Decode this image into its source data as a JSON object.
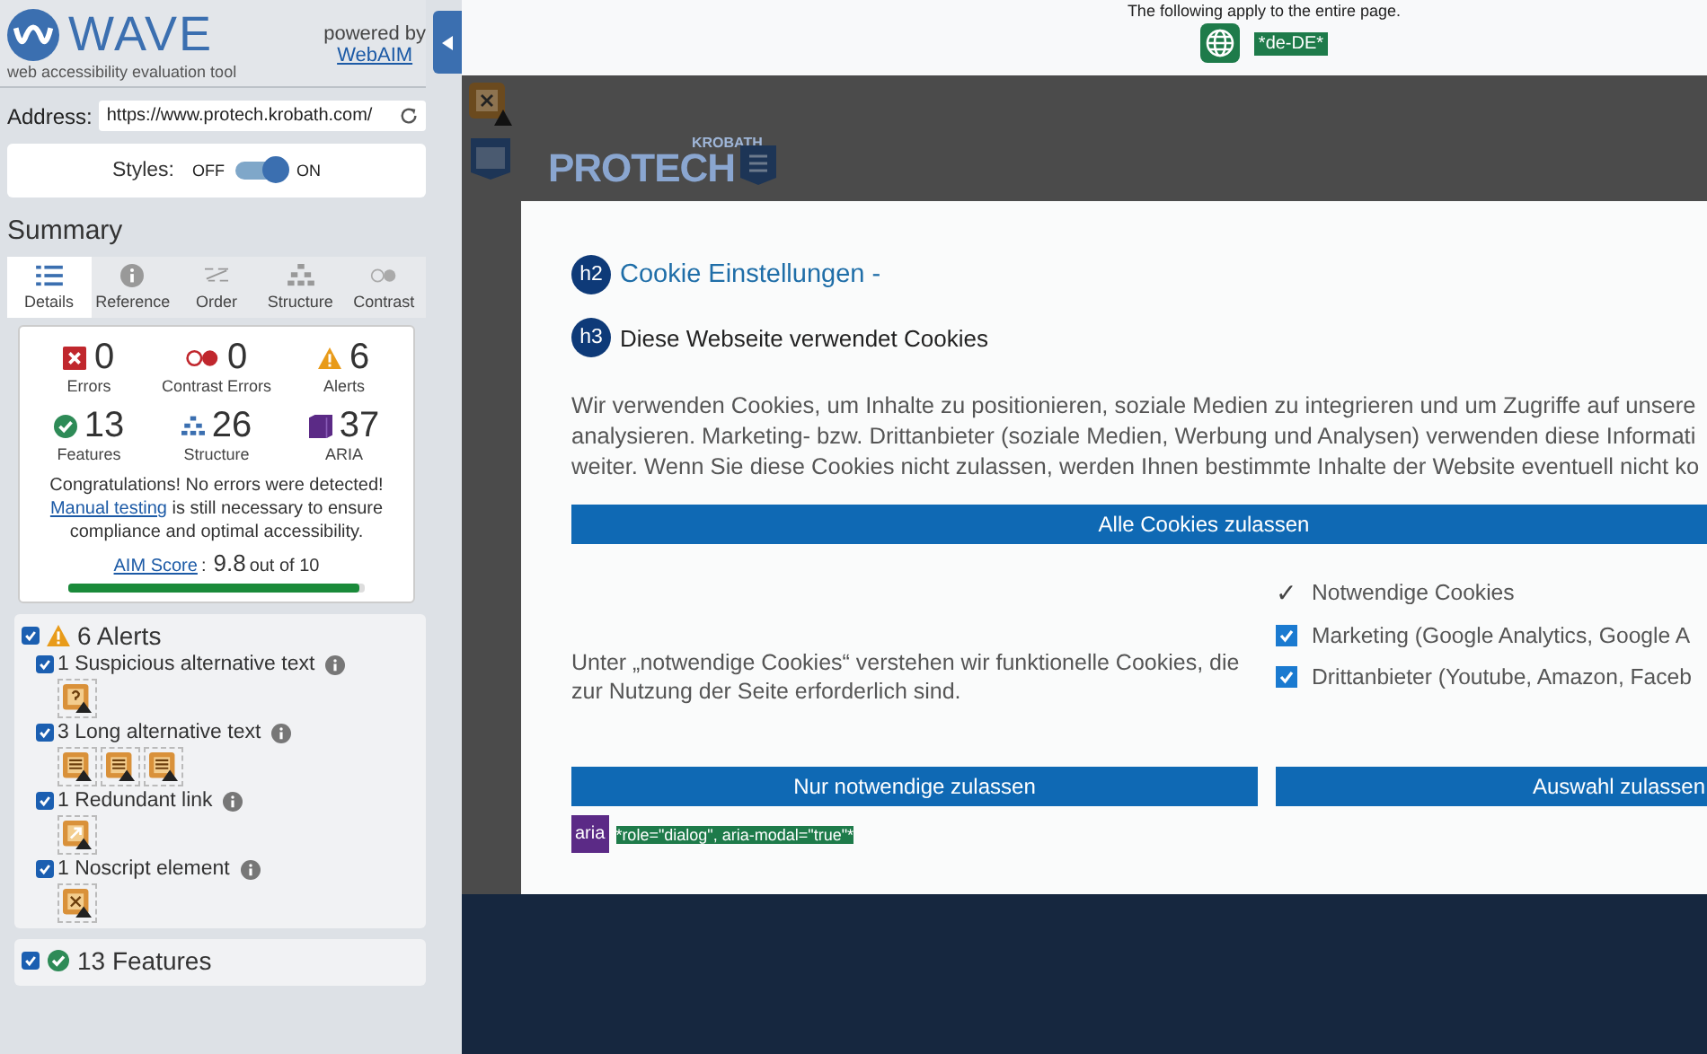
{
  "sidebar": {
    "logo": {
      "name": "WAVE",
      "tagline": "web accessibility evaluation tool"
    },
    "powered_by": "powered by",
    "webaim_link": "WebAIM",
    "address": {
      "label": "Address:",
      "value": "https://www.protech.krobath.com/"
    },
    "styles": {
      "label": "Styles:",
      "off_label": "OFF",
      "on_label": "ON",
      "on": true
    },
    "summary_title": "Summary",
    "tabs": [
      {
        "label": "Details",
        "kind": "details",
        "selected": true
      },
      {
        "label": "Reference",
        "kind": "reference",
        "selected": false
      },
      {
        "label": "Order",
        "kind": "order",
        "selected": false
      },
      {
        "label": "Structure",
        "kind": "structure",
        "selected": false
      },
      {
        "label": "Contrast",
        "kind": "contrast",
        "selected": false
      }
    ],
    "stats": [
      {
        "kind": "errors",
        "count": "0",
        "label": "Errors"
      },
      {
        "kind": "contrast",
        "count": "0",
        "label": "Contrast Errors"
      },
      {
        "kind": "alerts",
        "count": "6",
        "label": "Alerts"
      },
      {
        "kind": "features",
        "count": "13",
        "label": "Features"
      },
      {
        "kind": "structure",
        "count": "26",
        "label": "Structure"
      },
      {
        "kind": "aria",
        "count": "37",
        "label": "ARIA"
      }
    ],
    "message": {
      "before": "Congratulations! No errors were detected! ",
      "link": "Manual testing",
      "after": " is still necessary to ensure compliance and optimal accessibility."
    },
    "aim_score": {
      "label": "AIM Score",
      "separator": ":",
      "value": "9.8",
      "suffix": "out of 10",
      "level": 0.98
    },
    "alerts": {
      "checked": true,
      "title": "6 Alerts",
      "items": [
        {
          "label": "1 Suspicious alternative text",
          "checked": true,
          "icons": [
            {
              "kind": "suspicious"
            }
          ]
        },
        {
          "label": "3 Long alternative text",
          "checked": true,
          "icons": [
            {
              "kind": "long"
            },
            {
              "kind": "long"
            },
            {
              "kind": "long"
            }
          ]
        },
        {
          "label": "1 Redundant link",
          "checked": true,
          "icons": [
            {
              "kind": "redundant"
            }
          ]
        },
        {
          "label": "1 Noscript element",
          "checked": true,
          "icons": [
            {
              "kind": "noscript"
            }
          ]
        }
      ]
    },
    "features": {
      "checked": true,
      "title": "13 Features"
    }
  },
  "page": {
    "notice": "The following apply to the entire page.",
    "language": "*de-DE*",
    "overlay_icons": [
      {
        "kind": "noscript"
      },
      {
        "kind": "document"
      }
    ],
    "logo": {
      "top": "KROBATH",
      "name": "PROTECH"
    },
    "dialog": {
      "h2_badge": "h2",
      "heading": "Cookie Einstellungen -",
      "h3_badge": "h3",
      "subheading": "Diese Webseite verwendet Cookies",
      "lines": [
        "Wir verwenden Cookies, um Inhalte zu positionieren, soziale Medien zu integrieren und um Zugriffe auf unsere",
        "analysieren. Marketing- bzw. Drittanbieter (soziale Medien, Werbung und Analysen) verwenden diese Informati",
        "weiter. Wenn Sie diese Cookies nicht zulassen, werden Ihnen bestimmte Inhalte der Website eventuell nicht ko"
      ],
      "accept_all": "Alle Cookies zulassen",
      "note": "Unter „notwendige Cookies“ verstehen wir funktionelle Cookies, die zur Nutzung der Seite erforderlich sind.",
      "options": [
        {
          "kind": "fixed",
          "mark": "✓",
          "label": "Notwendige Cookies"
        },
        {
          "kind": "checkbox",
          "checked": true,
          "label": "Marketing (Google Analytics, Google A"
        },
        {
          "kind": "checkbox",
          "checked": true,
          "label": "Drittanbieter (Youtube, Amazon, Faceb"
        }
      ],
      "buttons": [
        "Nur notwendige zulassen",
        "Auswahl zulassen"
      ],
      "aria_badge": "aria",
      "aria_label": "*role=\"dialog\", aria-modal=\"true\"*"
    }
  }
}
